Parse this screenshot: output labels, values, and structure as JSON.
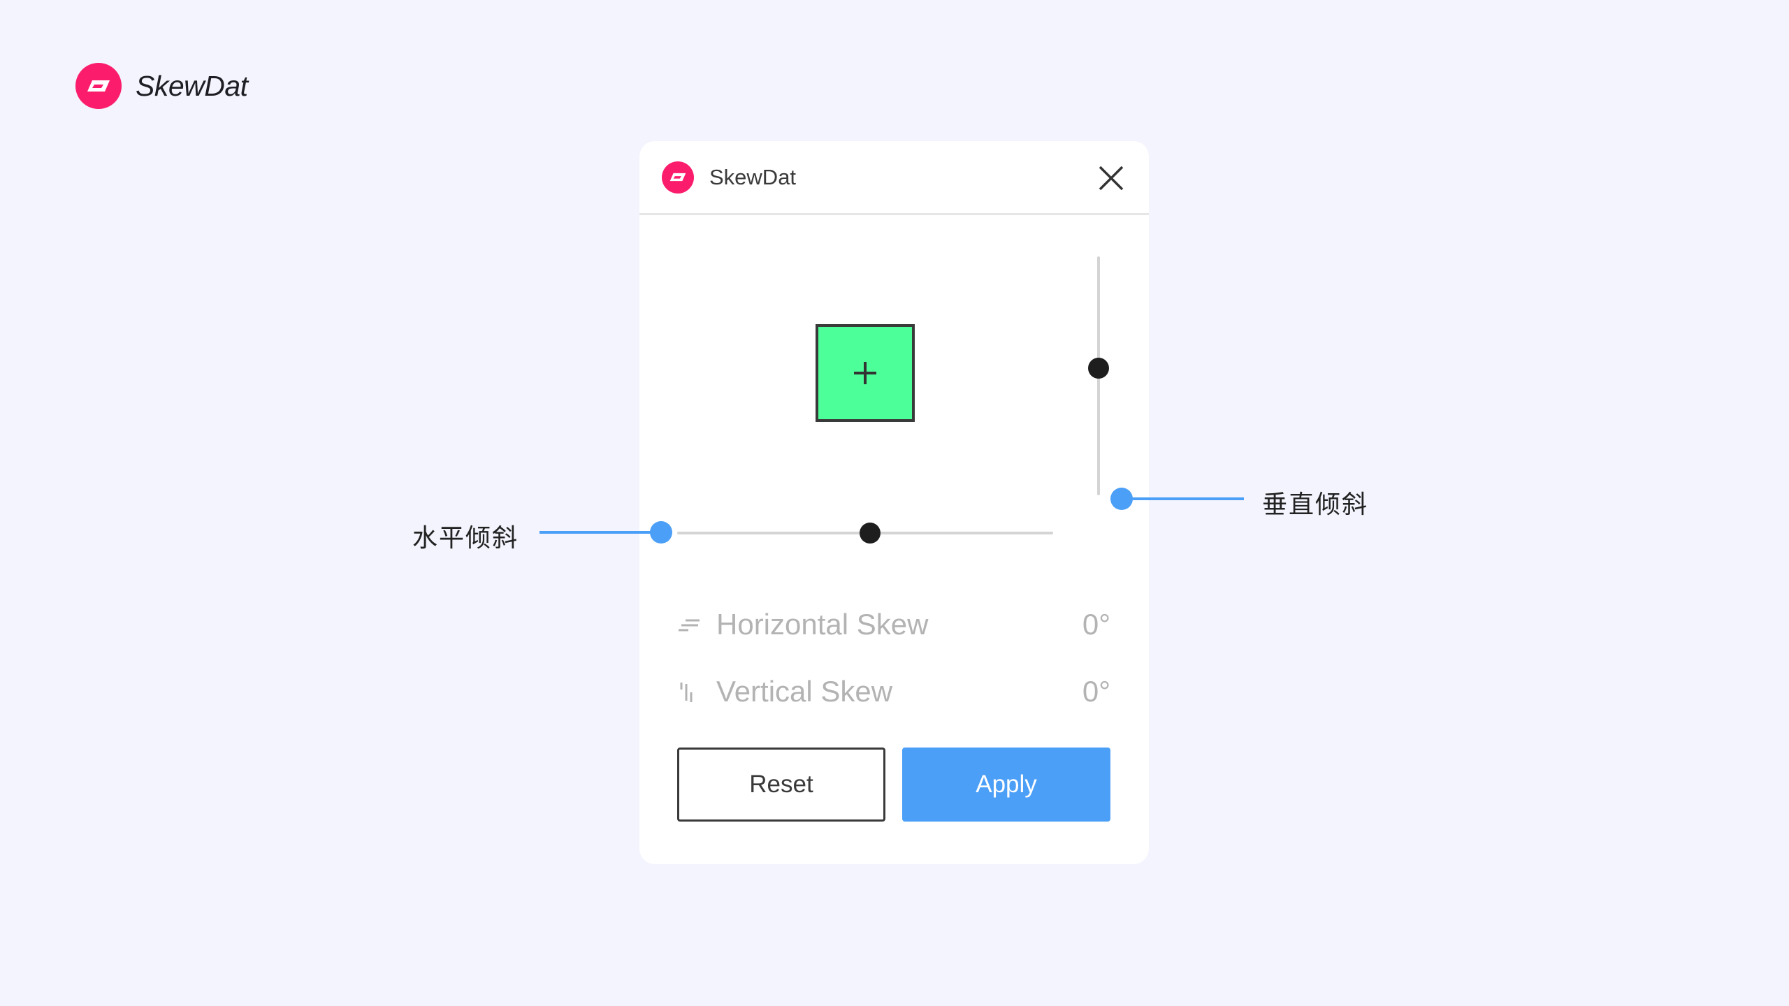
{
  "brand": {
    "name": "SkewDat",
    "logo_icon": "skewdat-logo-icon",
    "color": "#fb1d6c"
  },
  "dialog": {
    "title": "SkewDat",
    "close_icon": "close-icon",
    "preview": {
      "fill": "#4cff98",
      "center_icon": "plus-icon"
    },
    "parameters": [
      {
        "icon": "horizontal-skew-icon",
        "label": "Horizontal Skew",
        "value": "0°"
      },
      {
        "icon": "vertical-skew-icon",
        "label": "Vertical Skew",
        "value": "0°"
      }
    ],
    "buttons": {
      "reset": "Reset",
      "apply": "Apply"
    },
    "accent": "#4b9ff7"
  },
  "annotations": {
    "horizontal": "水平倾斜",
    "vertical": "垂直倾斜",
    "color": "#4b9ff7"
  }
}
